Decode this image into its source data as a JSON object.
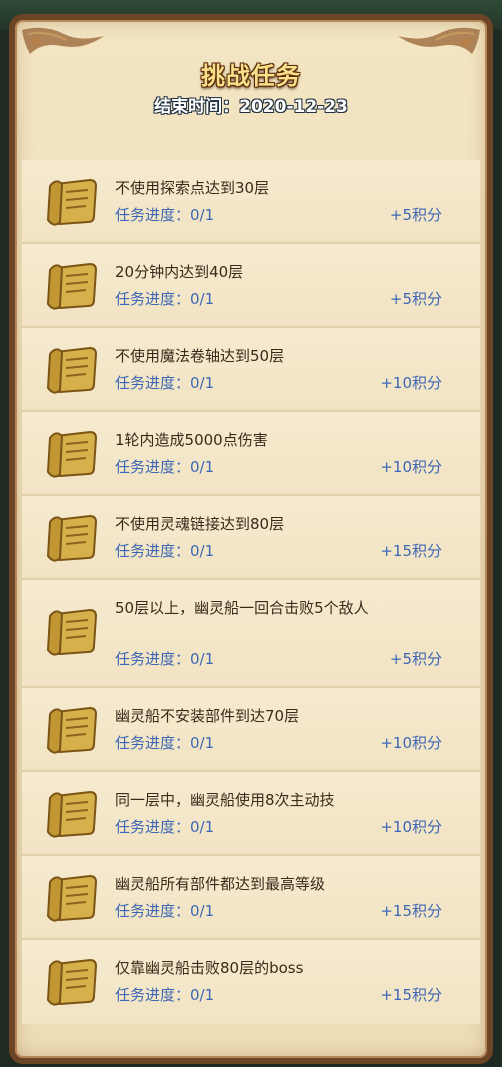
{
  "header": {
    "title": "挑战任务",
    "end_time": "结束时间：2020-12-23"
  },
  "tasks": [
    {
      "title": "不使用探索点达到30层",
      "progress": "任务进度：0/1",
      "points": "+5积分"
    },
    {
      "title": "20分钟内达到40层",
      "progress": "任务进度：0/1",
      "points": "+5积分"
    },
    {
      "title": "不使用魔法卷轴达到50层",
      "progress": "任务进度：0/1",
      "points": "+10积分"
    },
    {
      "title": "1轮内造成5000点伤害",
      "progress": "任务进度：0/1",
      "points": "+10积分"
    },
    {
      "title": "不使用灵魂链接达到80层",
      "progress": "任务进度：0/1",
      "points": "+15积分"
    },
    {
      "title": "50层以上，幽灵船一回合击败5个敌人",
      "progress": "任务进度：0/1",
      "points": "+5积分"
    },
    {
      "title": "幽灵船不安装部件到达70层",
      "progress": "任务进度：0/1",
      "points": "+10积分"
    },
    {
      "title": "同一层中，幽灵船使用8次主动技",
      "progress": "任务进度：0/1",
      "points": "+10积分"
    },
    {
      "title": "幽灵船所有部件都达到最高等级",
      "progress": "任务进度：0/1",
      "points": "+15积分"
    },
    {
      "title": "仅靠幽灵船击败80层的boss",
      "progress": "任务进度：0/1",
      "points": "+15积分"
    }
  ],
  "icons": {
    "task_icon": "scroll-icon"
  },
  "colors": {
    "progress_text": "#3d67b5",
    "title_text": "#f9e08a",
    "frame": "#6b4526"
  }
}
